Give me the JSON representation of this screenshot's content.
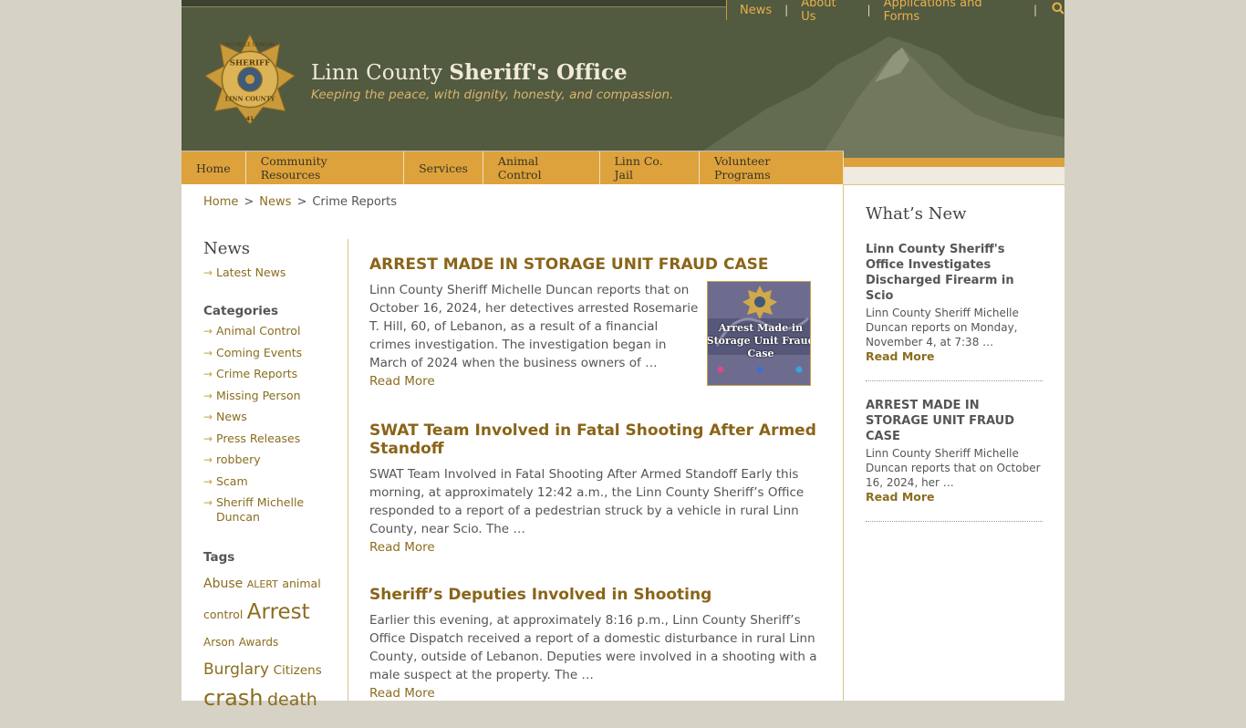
{
  "colors": {
    "header_bg": "#525a40",
    "nav_bg": "#dda23c",
    "link": "#8a6d1e",
    "title_link": "#8a6418",
    "page_bg": "#d6d2c6"
  },
  "utility_nav": {
    "items": [
      "News",
      "About Us",
      "Applications and Forms"
    ],
    "separator": "|",
    "search_icon": "search-icon"
  },
  "site": {
    "title_light": "Linn County ",
    "title_bold": "Sheriff's Office",
    "tagline": "Keeping the peace, with dignity, honesty, and compassion.",
    "badge": {
      "top_text": "MICHELLE DUNCAN",
      "word1": "SHERIFF",
      "word2": "LINN COUNTY",
      "bottom_text": "41"
    }
  },
  "main_nav": [
    "Home",
    "Community Resources",
    "Services",
    "Animal Control",
    "Linn Co. Jail",
    "Volunteer Programs"
  ],
  "breadcrumb": {
    "home": "Home",
    "news": "News",
    "current": "Crime Reports",
    "sep": ">"
  },
  "left_nav": {
    "heading": "News",
    "latest": "Latest News",
    "categories_heading": "Categories",
    "categories": [
      "Animal Control",
      "Coming Events",
      "Crime Reports",
      "Missing Person",
      "News",
      "Press Releases",
      "robbery",
      "Scam",
      "Sheriff Michelle Duncan"
    ],
    "tags_heading": "Tags",
    "tags": [
      "Abuse",
      "ALERT",
      "animal control",
      "Arrest",
      "Arson",
      "Awards",
      "Burglary",
      "Citizens",
      "crash",
      "death"
    ]
  },
  "articles": [
    {
      "title": "ARREST MADE IN STORAGE UNIT FRAUD CASE",
      "body": "Linn County Sheriff Michelle Duncan reports that on October 16, 2024, her detectives arrested Rosemarie T. Hill, 60, of Lebanon, as a result of a financial crimes investigation.  The investigation began in March of 2024 when the business owners of …",
      "read_more": "Read More",
      "thumb_text": "Arrest Made in Storage Unit Fraud Case"
    },
    {
      "title": "SWAT Team Involved in Fatal Shooting After Armed Standoff",
      "body": "SWAT Team Involved in Fatal Shooting After Armed Standoff   Early this morning, at approximately 12:42 a.m., the Linn County Sheriff’s Office responded to a report of a pedestrian struck by a vehicle in rural Linn County, near Scio. The …",
      "read_more": "Read More"
    },
    {
      "title": "Sheriff’s Deputies Involved in Shooting",
      "body": "Earlier this evening, at approximately 8:16 p.m., Linn County Sheriff’s Office Dispatch received a report of a domestic disturbance in rural Linn County, outside of Lebanon. Deputies were involved in a shooting with a male suspect at the property. The …",
      "read_more": "Read More"
    }
  ],
  "whats_new": {
    "heading": "What’s New",
    "items": [
      {
        "title": "Linn County Sheriff's Office Investigates Discharged Firearm in Scio",
        "body": "Linn County Sheriff Michelle Duncan reports on Monday, November 4, at 7:38 …",
        "read_more": "Read More"
      },
      {
        "title": "ARREST MADE IN STORAGE UNIT FRAUD CASE",
        "body": "Linn County Sheriff Michelle Duncan reports that on October 16, 2024, her …",
        "read_more": "Read More"
      }
    ]
  }
}
